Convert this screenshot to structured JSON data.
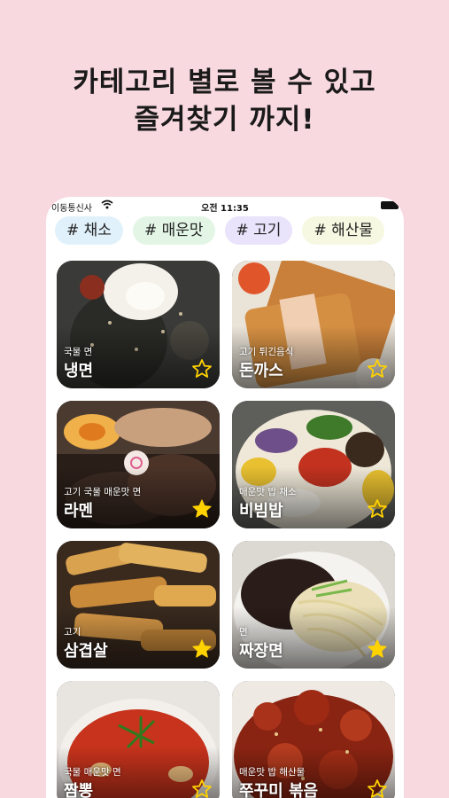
{
  "headline": {
    "line1": "카테고리 별로 볼 수 있고",
    "line2": "즐겨찾기 까지!"
  },
  "status_bar": {
    "carrier": "이동통신사",
    "time": "오전 11:35"
  },
  "categories": [
    "# 채소",
    "# 매운맛",
    "# 고기",
    "# 해산물"
  ],
  "foods": [
    {
      "name": "냉면",
      "tags": "국물 면",
      "favorite": false
    },
    {
      "name": "돈까스",
      "tags": "고기 튀긴음식",
      "favorite": false
    },
    {
      "name": "라멘",
      "tags": "고기 국물 매운맛 면",
      "favorite": true
    },
    {
      "name": "비빔밥",
      "tags": "매운맛 밥 채소",
      "favorite": false
    },
    {
      "name": "삼겹살",
      "tags": "고기",
      "favorite": true
    },
    {
      "name": "짜장면",
      "tags": "면",
      "favorite": true
    },
    {
      "name": "짬뽕",
      "tags": "국물 매운맛 면",
      "favorite": false
    },
    {
      "name": "쭈꾸미 볶음",
      "tags": "매운맛 밥 해산물",
      "favorite": false
    }
  ],
  "colors": {
    "background": "#f8d9df",
    "star_filled": "#ffd200",
    "star_outline": "#ffd200"
  },
  "icons": {
    "wifi": "wifi-icon",
    "battery": "battery-icon",
    "favorite": "star-icon"
  }
}
